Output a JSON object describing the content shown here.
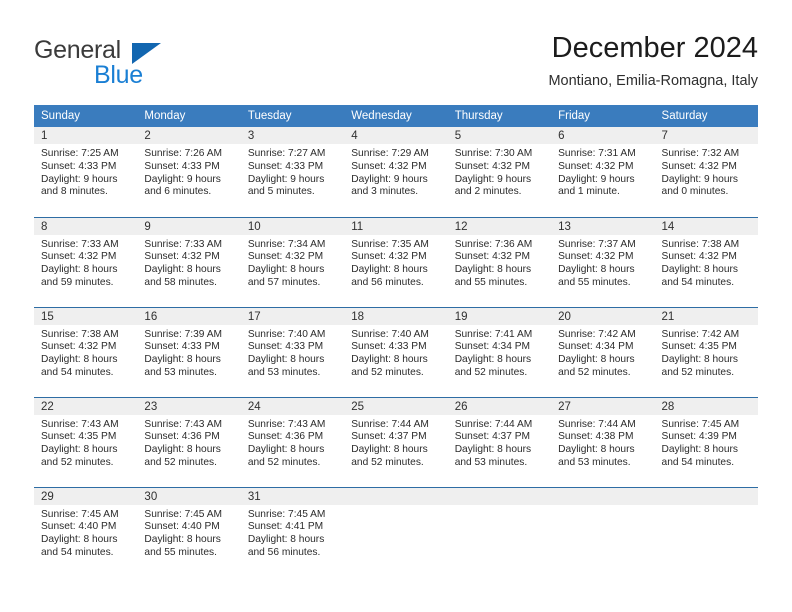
{
  "brand": {
    "name_top": "General",
    "name_bottom": "Blue",
    "color_primary": "#1266b0",
    "color_secondary": "#1a7fd4"
  },
  "header": {
    "title": "December 2024",
    "subtitle": "Montiano, Emilia-Romagna, Italy"
  },
  "theme": {
    "header_bg": "#3a7cbe",
    "row_line": "#2e6da4",
    "daynum_bg": "#efefef",
    "text": "#2b2b2b"
  },
  "weekday_headers": [
    "Sunday",
    "Monday",
    "Tuesday",
    "Wednesday",
    "Thursday",
    "Friday",
    "Saturday"
  ],
  "weeks": [
    [
      {
        "day": "1",
        "sunrise": "Sunrise: 7:25 AM",
        "sunset": "Sunset: 4:33 PM",
        "daylight_1": "Daylight: 9 hours",
        "daylight_2": "and 8 minutes."
      },
      {
        "day": "2",
        "sunrise": "Sunrise: 7:26 AM",
        "sunset": "Sunset: 4:33 PM",
        "daylight_1": "Daylight: 9 hours",
        "daylight_2": "and 6 minutes."
      },
      {
        "day": "3",
        "sunrise": "Sunrise: 7:27 AM",
        "sunset": "Sunset: 4:33 PM",
        "daylight_1": "Daylight: 9 hours",
        "daylight_2": "and 5 minutes."
      },
      {
        "day": "4",
        "sunrise": "Sunrise: 7:29 AM",
        "sunset": "Sunset: 4:32 PM",
        "daylight_1": "Daylight: 9 hours",
        "daylight_2": "and 3 minutes."
      },
      {
        "day": "5",
        "sunrise": "Sunrise: 7:30 AM",
        "sunset": "Sunset: 4:32 PM",
        "daylight_1": "Daylight: 9 hours",
        "daylight_2": "and 2 minutes."
      },
      {
        "day": "6",
        "sunrise": "Sunrise: 7:31 AM",
        "sunset": "Sunset: 4:32 PM",
        "daylight_1": "Daylight: 9 hours",
        "daylight_2": "and 1 minute."
      },
      {
        "day": "7",
        "sunrise": "Sunrise: 7:32 AM",
        "sunset": "Sunset: 4:32 PM",
        "daylight_1": "Daylight: 9 hours",
        "daylight_2": "and 0 minutes."
      }
    ],
    [
      {
        "day": "8",
        "sunrise": "Sunrise: 7:33 AM",
        "sunset": "Sunset: 4:32 PM",
        "daylight_1": "Daylight: 8 hours",
        "daylight_2": "and 59 minutes."
      },
      {
        "day": "9",
        "sunrise": "Sunrise: 7:33 AM",
        "sunset": "Sunset: 4:32 PM",
        "daylight_1": "Daylight: 8 hours",
        "daylight_2": "and 58 minutes."
      },
      {
        "day": "10",
        "sunrise": "Sunrise: 7:34 AM",
        "sunset": "Sunset: 4:32 PM",
        "daylight_1": "Daylight: 8 hours",
        "daylight_2": "and 57 minutes."
      },
      {
        "day": "11",
        "sunrise": "Sunrise: 7:35 AM",
        "sunset": "Sunset: 4:32 PM",
        "daylight_1": "Daylight: 8 hours",
        "daylight_2": "and 56 minutes."
      },
      {
        "day": "12",
        "sunrise": "Sunrise: 7:36 AM",
        "sunset": "Sunset: 4:32 PM",
        "daylight_1": "Daylight: 8 hours",
        "daylight_2": "and 55 minutes."
      },
      {
        "day": "13",
        "sunrise": "Sunrise: 7:37 AM",
        "sunset": "Sunset: 4:32 PM",
        "daylight_1": "Daylight: 8 hours",
        "daylight_2": "and 55 minutes."
      },
      {
        "day": "14",
        "sunrise": "Sunrise: 7:38 AM",
        "sunset": "Sunset: 4:32 PM",
        "daylight_1": "Daylight: 8 hours",
        "daylight_2": "and 54 minutes."
      }
    ],
    [
      {
        "day": "15",
        "sunrise": "Sunrise: 7:38 AM",
        "sunset": "Sunset: 4:32 PM",
        "daylight_1": "Daylight: 8 hours",
        "daylight_2": "and 54 minutes."
      },
      {
        "day": "16",
        "sunrise": "Sunrise: 7:39 AM",
        "sunset": "Sunset: 4:33 PM",
        "daylight_1": "Daylight: 8 hours",
        "daylight_2": "and 53 minutes."
      },
      {
        "day": "17",
        "sunrise": "Sunrise: 7:40 AM",
        "sunset": "Sunset: 4:33 PM",
        "daylight_1": "Daylight: 8 hours",
        "daylight_2": "and 53 minutes."
      },
      {
        "day": "18",
        "sunrise": "Sunrise: 7:40 AM",
        "sunset": "Sunset: 4:33 PM",
        "daylight_1": "Daylight: 8 hours",
        "daylight_2": "and 52 minutes."
      },
      {
        "day": "19",
        "sunrise": "Sunrise: 7:41 AM",
        "sunset": "Sunset: 4:34 PM",
        "daylight_1": "Daylight: 8 hours",
        "daylight_2": "and 52 minutes."
      },
      {
        "day": "20",
        "sunrise": "Sunrise: 7:42 AM",
        "sunset": "Sunset: 4:34 PM",
        "daylight_1": "Daylight: 8 hours",
        "daylight_2": "and 52 minutes."
      },
      {
        "day": "21",
        "sunrise": "Sunrise: 7:42 AM",
        "sunset": "Sunset: 4:35 PM",
        "daylight_1": "Daylight: 8 hours",
        "daylight_2": "and 52 minutes."
      }
    ],
    [
      {
        "day": "22",
        "sunrise": "Sunrise: 7:43 AM",
        "sunset": "Sunset: 4:35 PM",
        "daylight_1": "Daylight: 8 hours",
        "daylight_2": "and 52 minutes."
      },
      {
        "day": "23",
        "sunrise": "Sunrise: 7:43 AM",
        "sunset": "Sunset: 4:36 PM",
        "daylight_1": "Daylight: 8 hours",
        "daylight_2": "and 52 minutes."
      },
      {
        "day": "24",
        "sunrise": "Sunrise: 7:43 AM",
        "sunset": "Sunset: 4:36 PM",
        "daylight_1": "Daylight: 8 hours",
        "daylight_2": "and 52 minutes."
      },
      {
        "day": "25",
        "sunrise": "Sunrise: 7:44 AM",
        "sunset": "Sunset: 4:37 PM",
        "daylight_1": "Daylight: 8 hours",
        "daylight_2": "and 52 minutes."
      },
      {
        "day": "26",
        "sunrise": "Sunrise: 7:44 AM",
        "sunset": "Sunset: 4:37 PM",
        "daylight_1": "Daylight: 8 hours",
        "daylight_2": "and 53 minutes."
      },
      {
        "day": "27",
        "sunrise": "Sunrise: 7:44 AM",
        "sunset": "Sunset: 4:38 PM",
        "daylight_1": "Daylight: 8 hours",
        "daylight_2": "and 53 minutes."
      },
      {
        "day": "28",
        "sunrise": "Sunrise: 7:45 AM",
        "sunset": "Sunset: 4:39 PM",
        "daylight_1": "Daylight: 8 hours",
        "daylight_2": "and 54 minutes."
      }
    ],
    [
      {
        "day": "29",
        "sunrise": "Sunrise: 7:45 AM",
        "sunset": "Sunset: 4:40 PM",
        "daylight_1": "Daylight: 8 hours",
        "daylight_2": "and 54 minutes."
      },
      {
        "day": "30",
        "sunrise": "Sunrise: 7:45 AM",
        "sunset": "Sunset: 4:40 PM",
        "daylight_1": "Daylight: 8 hours",
        "daylight_2": "and 55 minutes."
      },
      {
        "day": "31",
        "sunrise": "Sunrise: 7:45 AM",
        "sunset": "Sunset: 4:41 PM",
        "daylight_1": "Daylight: 8 hours",
        "daylight_2": "and 56 minutes."
      },
      {
        "day": "",
        "sunrise": "",
        "sunset": "",
        "daylight_1": "",
        "daylight_2": ""
      },
      {
        "day": "",
        "sunrise": "",
        "sunset": "",
        "daylight_1": "",
        "daylight_2": ""
      },
      {
        "day": "",
        "sunrise": "",
        "sunset": "",
        "daylight_1": "",
        "daylight_2": ""
      },
      {
        "day": "",
        "sunrise": "",
        "sunset": "",
        "daylight_1": "",
        "daylight_2": ""
      }
    ]
  ]
}
